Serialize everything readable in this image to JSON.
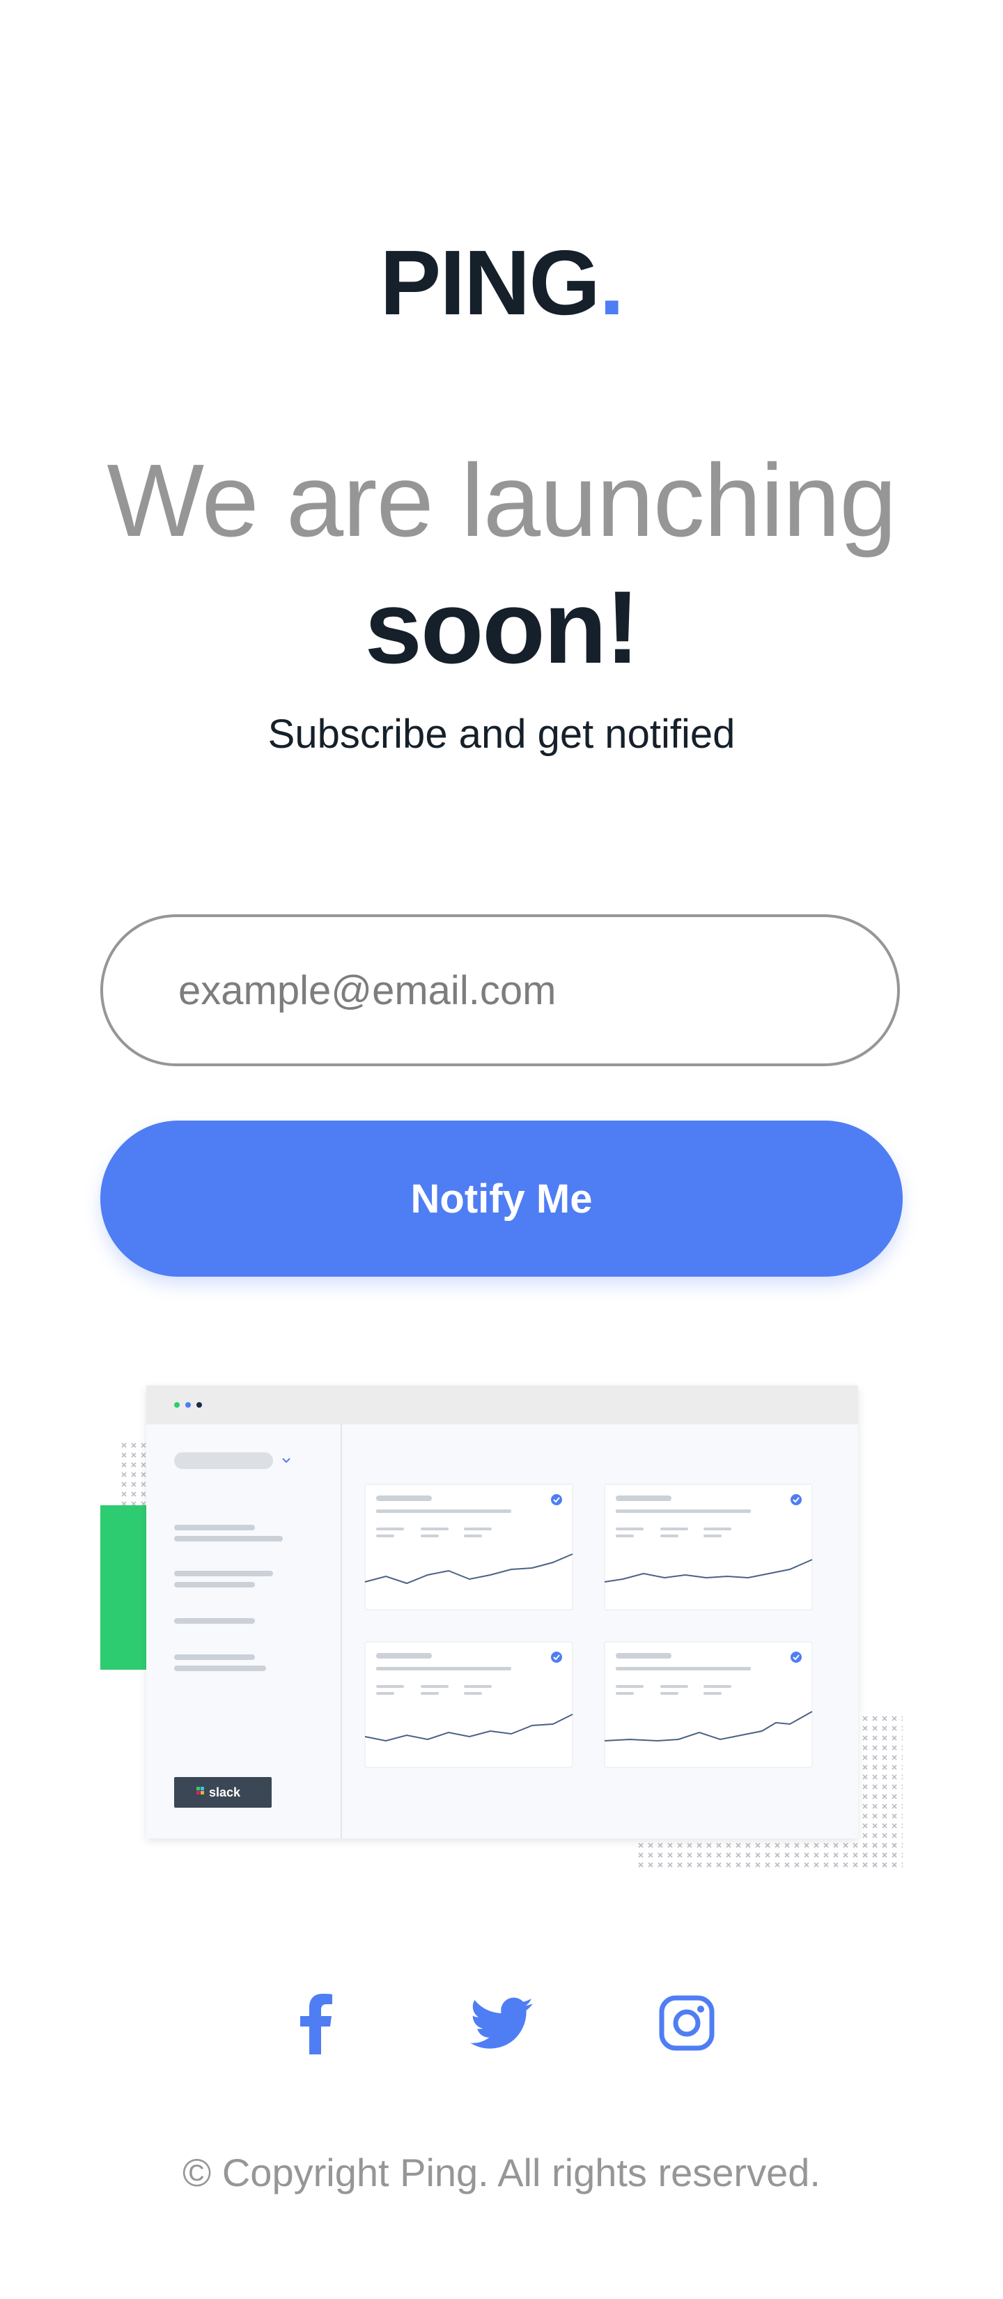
{
  "logo": {
    "text": "PING",
    "accent": "."
  },
  "headline": {
    "light": "We are launching",
    "bold": "soon!"
  },
  "subtitle": "Subscribe and get notified",
  "form": {
    "email_placeholder": "example@email.com",
    "email_value": "",
    "submit_label": "Notify Me"
  },
  "illustration": {
    "slack_label": "slack"
  },
  "socials": [
    {
      "name": "facebook",
      "icon": "facebook-icon"
    },
    {
      "name": "twitter",
      "icon": "twitter-icon"
    },
    {
      "name": "instagram",
      "icon": "instagram-icon"
    }
  ],
  "footer": "© Copyright Ping. All rights reserved.",
  "colors": {
    "accent": "#4f7df3",
    "dark": "#15202a",
    "gray": "#969696",
    "green": "#2ecc71"
  }
}
